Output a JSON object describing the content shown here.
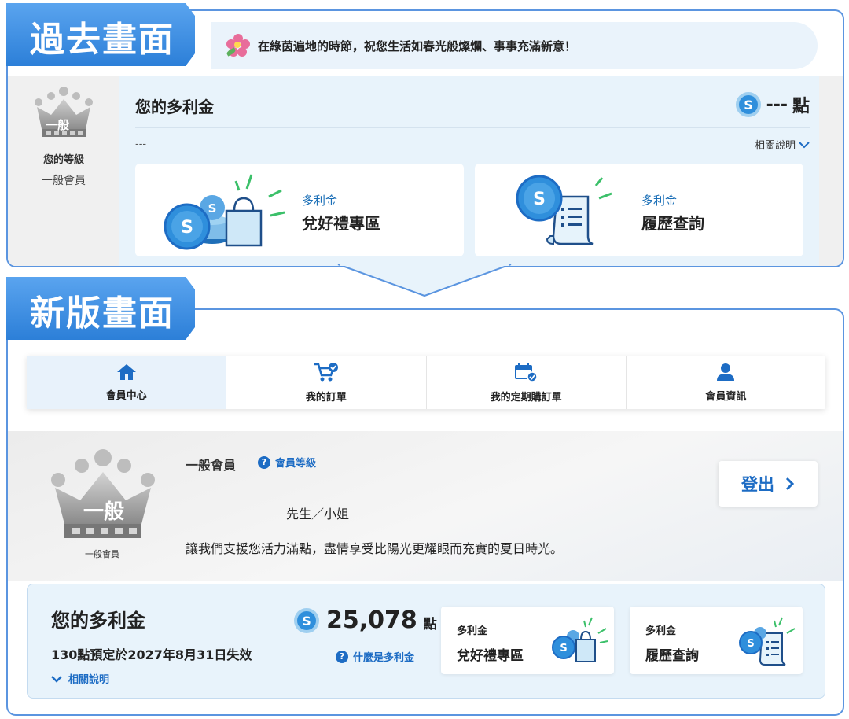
{
  "old": {
    "tag": "過去畫面",
    "banner": "在綠茵遍地的時節，祝您生活如春光般燦爛、事事充滿新意！",
    "sidebar": {
      "crown_text": "一般",
      "level_label": "您的等級",
      "level_value": "一般會員"
    },
    "title": "您的多利金",
    "points_value": "---",
    "points_unit": "點",
    "dash_text": "---",
    "related_label": "相關說明",
    "cards": [
      {
        "sub": "多利金",
        "main": "兌好禮專區"
      },
      {
        "sub": "多利金",
        "main": "履歷查詢"
      }
    ]
  },
  "new": {
    "tag": "新版畫面",
    "nav": [
      {
        "label": "會員中心",
        "icon": "home-icon"
      },
      {
        "label": "我的訂單",
        "icon": "cart-check-icon"
      },
      {
        "label": "我的定期購訂單",
        "icon": "calendar-check-icon"
      },
      {
        "label": "會員資訊",
        "icon": "user-icon"
      }
    ],
    "hero": {
      "crown_text": "一般",
      "crown_label": "一般會員",
      "member_level": "一般會員",
      "level_link": "會員等級",
      "salutation": "先生／小姐",
      "welcome": "讓我們支援您活力滿點，盡情享受比陽光更耀眼而充實的夏日時光。",
      "logout_label": "登出"
    },
    "points": {
      "title": "您的多利金",
      "expire_note": "130點預定於2027年8月31日失效",
      "related_label": "相關說明",
      "value": "25,078",
      "unit": "點",
      "what_label": "什麼是多利金",
      "cards": [
        {
          "sub": "多利金",
          "main": "兌好禮專區"
        },
        {
          "sub": "多利金",
          "main": "履歷查詢"
        }
      ]
    }
  },
  "colors": {
    "accent": "#1d6cc4",
    "frame": "#5b95e0",
    "panel": "#e8f3fb"
  }
}
